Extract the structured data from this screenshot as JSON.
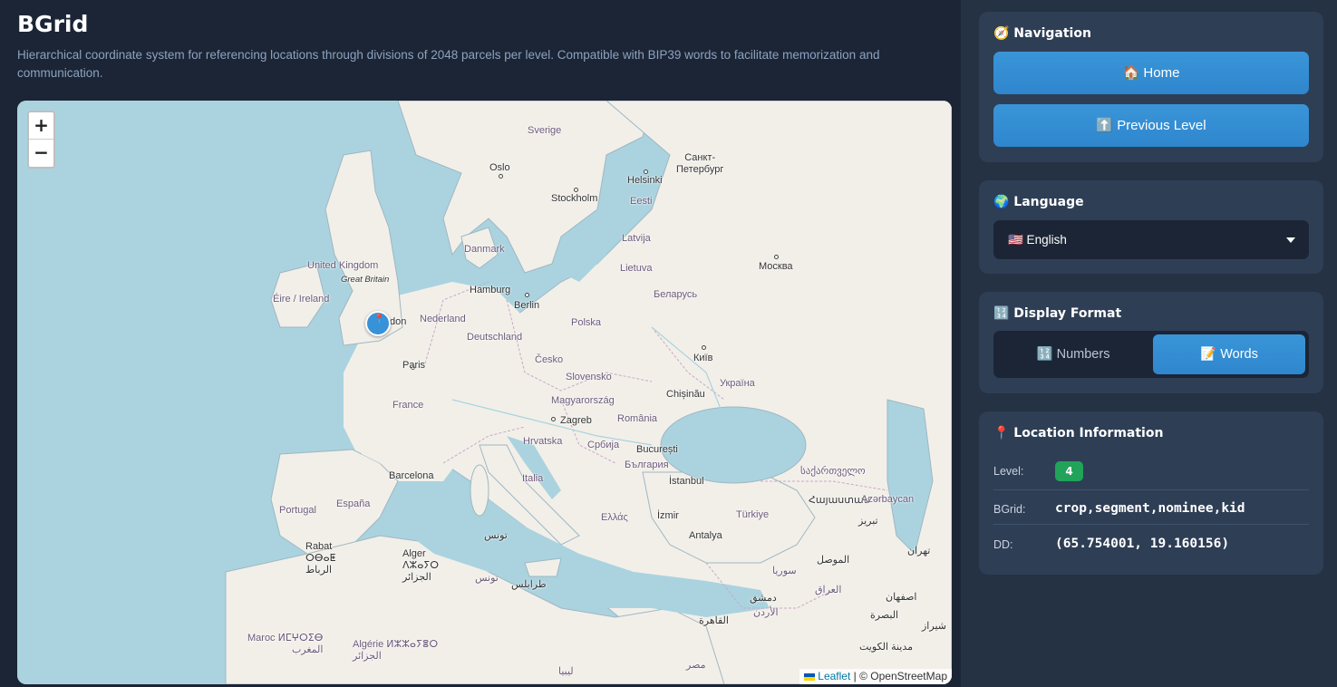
{
  "header": {
    "title": "BGrid",
    "description": "Hierarchical coordinate system for referencing locations through divisions of 2048 parcels per level. Compatible with BIP39 words to facilitate memorization and communication."
  },
  "map": {
    "zoom_in": "+",
    "zoom_out": "−",
    "attribution_leaflet": "Leaflet",
    "attribution_rest": " | © OpenStreetMap",
    "labels": {
      "sverige": "Sverige",
      "oslo": "Oslo",
      "stockholm": "Stockholm",
      "helsinki": "Helsinki",
      "spb": "Санкт-\nПетербург",
      "eesti": "Eesti",
      "danmark": "Danmark",
      "latvija": "Latvija",
      "lietuva": "Lietuva",
      "moskva": "Москва",
      "uk": "United Kingdom",
      "gb": "Great Britain",
      "eire": "Éire / Ireland",
      "hamburg": "Hamburg",
      "berlin": "Berlin",
      "belarus": "Беларусь",
      "nederland": "Nederland",
      "london": "don",
      "polska": "Polska",
      "deutschland": "Deutschland",
      "cesko": "Česko",
      "kyiv": "Київ",
      "paris": "Paris",
      "slovensko": "Slovensko",
      "ukraina": "Україна",
      "magyar": "Magyarország",
      "chisinau": "Chișinău",
      "france": "France",
      "zagreb": "Zagreb",
      "romania": "România",
      "hrvatska": "Hrvatska",
      "srbija": "Србија",
      "bucuresti": "București",
      "barcelona": "Barcelona",
      "bulgaria": "България",
      "italia": "Italia",
      "istanbul": "İstanbul",
      "georgia": "საქართველო",
      "portugal": "Portugal",
      "espana": "España",
      "armenia": "Հայաստան",
      "azerbaycan": "Azərbaycan",
      "ellas": "Ελλάς",
      "izmir": "İzmir",
      "turkiye": "Türkiye",
      "tabriz": "تبریز",
      "tunis": "تونس",
      "antalya": "Antalya",
      "rabat": "Rabat\nⵔⴱⴰⵟ\nالرباط",
      "alger": "Alger\nⴷⵣⴰⵢⵔ\nالجزائر",
      "tunis2": "تونس",
      "mosul": "الموصل",
      "tehran": "تهران",
      "syria": "سوريا",
      "tripoli": "طرابلس",
      "damascus": "دمشق",
      "iraq": "العراق",
      "jordan": "الأردن",
      "isfahan": "اصفهان",
      "basra": "البصرة",
      "cairo": "القاهرة",
      "shiraz": "شیراز",
      "maroc": "Maroc ⵍⵎⵖⵔⵉⴱ\nالمغرب",
      "algerie": "Algérie ⵍⵣⵣⴰⵢⴻⵔ\nالجزائر",
      "kuwait": "مدينة الكويت",
      "libya": "ليبيا",
      "misr": "مصر"
    }
  },
  "sidebar": {
    "navigation": {
      "title": "🧭 Navigation",
      "home_label": "🏠 Home",
      "previous_label": "⬆️ Previous Level"
    },
    "language": {
      "title": "🌍 Language",
      "selected": "🇺🇸 English"
    },
    "display_format": {
      "title": "🔢 Display Format",
      "numbers_label": "🔢 Numbers",
      "words_label": "📝 Words",
      "active": "words"
    },
    "location": {
      "title": "📍 Location Information",
      "level_label": "Level:",
      "level_value": "4",
      "bgrid_label": "BGrid:",
      "bgrid_value": "crop,segment,nominee,kid",
      "dd_label": "DD:",
      "dd_value": "(65.754001, 19.160156)"
    }
  },
  "colors": {
    "background": "#1b2535",
    "sidebar": "#253244",
    "card": "#2e3e55",
    "accent": "#3a95d8",
    "badge": "#21a35a",
    "sea": "#aad3df",
    "land": "#f2efe9"
  }
}
